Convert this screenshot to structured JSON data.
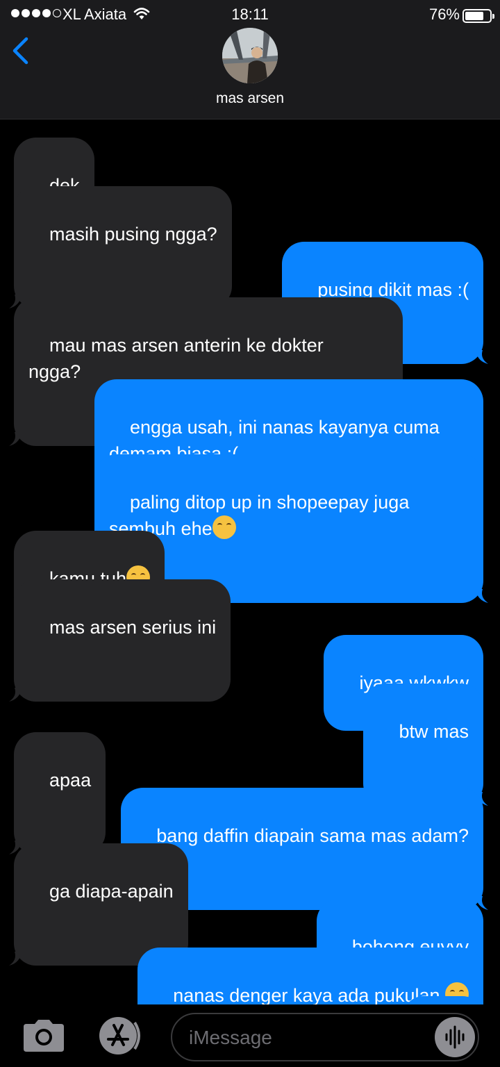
{
  "status_bar": {
    "carrier": "XL Axiata",
    "time": "18:11",
    "battery_percent_label": "76%",
    "battery_level": 0.76
  },
  "header": {
    "contact_name": "mas arsen"
  },
  "messages": [
    {
      "from": "them",
      "text": "dek"
    },
    {
      "from": "them",
      "text": "masih pusing ngga?"
    },
    {
      "from": "me",
      "text": "pusing dikit mas :("
    },
    {
      "from": "them",
      "text": "mau mas arsen anterin ke dokter\nngga?"
    },
    {
      "from": "me",
      "text": "engga usah, ini nanas kayanya cuma\ndemam biasa :("
    },
    {
      "from": "me",
      "text": "paling ditop up in shopeepay juga\nsembuh ehe",
      "emoji": "grinning-face"
    },
    {
      "from": "them",
      "text": "kamu tuh",
      "emoji": "unamused-face"
    },
    {
      "from": "them",
      "text": "mas arsen serius ini"
    },
    {
      "from": "me",
      "text": "iyaaa wkwkw"
    },
    {
      "from": "me",
      "text": "btw mas"
    },
    {
      "from": "them",
      "text": "apaa"
    },
    {
      "from": "me",
      "text": "bang daffin diapain sama mas adam?"
    },
    {
      "from": "them",
      "text": "ga diapa-apain"
    },
    {
      "from": "me",
      "text": "bohong euyyy"
    },
    {
      "from": "me",
      "text": "nanas denger kaya ada pukulan ",
      "emoji": "pleading-face"
    }
  ],
  "input_bar": {
    "placeholder": "iMessage"
  },
  "colors": {
    "incoming_bubble": "#262628",
    "outgoing_bubble": "#0a84ff",
    "accent": "#0a84ff"
  },
  "icons": [
    "back-chevron-icon",
    "camera-icon",
    "app-store-icon",
    "audio-waveform-icon",
    "wifi-icon",
    "battery-icon"
  ]
}
